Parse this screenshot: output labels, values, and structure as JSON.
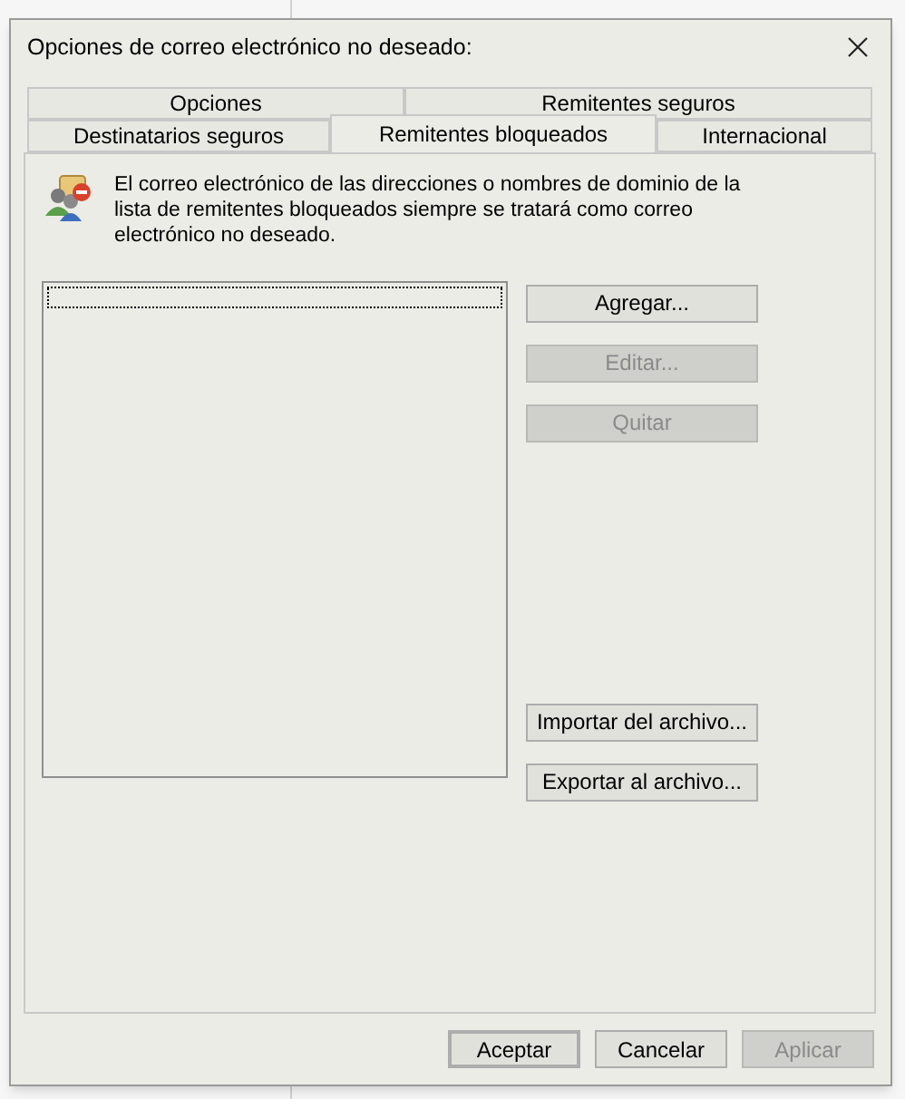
{
  "window": {
    "title": "Opciones de correo electrónico no deseado:"
  },
  "tab_rows": [
    [
      {
        "label": "Opciones",
        "selected": false
      },
      {
        "label": "Remitentes seguros",
        "selected": false
      }
    ],
    [
      {
        "label": "Destinatarios seguros",
        "selected": false
      },
      {
        "label": "Remitentes bloqueados",
        "selected": true
      },
      {
        "label": "Internacional",
        "selected": false
      }
    ]
  ],
  "description": "El correo electrónico de las direcciones o nombres de dominio de la lista de remitentes bloqueados siempre se tratará como correo electrónico no deseado.",
  "side_buttons": [
    {
      "label": "Agregar...",
      "disabled": false
    },
    {
      "label": "Editar...",
      "disabled": true
    },
    {
      "label": "Quitar",
      "disabled": true
    },
    {
      "label": "Importar del archivo...",
      "disabled": false
    },
    {
      "label": "Exportar al archivo...",
      "disabled": false
    }
  ],
  "footer_buttons": [
    {
      "label": "Aceptar",
      "disabled": false,
      "default": true
    },
    {
      "label": "Cancelar",
      "disabled": false,
      "default": false
    },
    {
      "label": "Aplicar",
      "disabled": true,
      "default": false
    }
  ]
}
